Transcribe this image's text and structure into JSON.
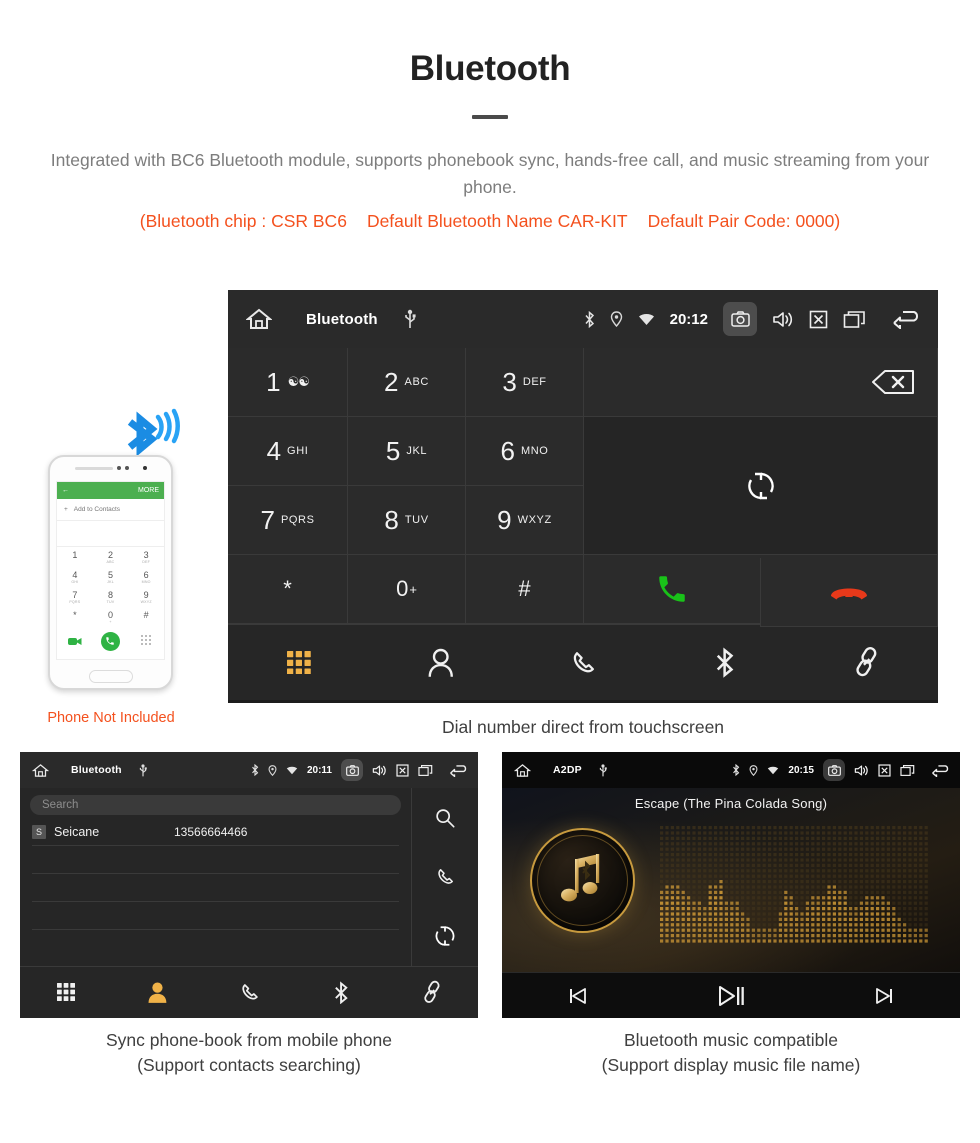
{
  "header": {
    "title": "Bluetooth",
    "subtitle": "Integrated with BC6 Bluetooth module, supports phonebook sync, hands-free call, and music streaming from your phone.",
    "spec_chip": "(Bluetooth chip : CSR BC6",
    "spec_name": "Default Bluetooth Name CAR-KIT",
    "spec_pair": "Default Pair Code: 0000)"
  },
  "colors": {
    "accent_orange": "#f4511e",
    "active_nav": "#f0b248",
    "call_green": "#19c219",
    "hangup_red": "#e8391a",
    "gold": "#c79a3e"
  },
  "phone_illustration": {
    "note": "Phone Not Included",
    "screen_header_more": "MORE",
    "add_contacts": "Add to Contacts",
    "keys": [
      {
        "num": "1",
        "sub": ""
      },
      {
        "num": "2",
        "sub": "ABC"
      },
      {
        "num": "3",
        "sub": "DEF"
      },
      {
        "num": "4",
        "sub": "GHI"
      },
      {
        "num": "5",
        "sub": "JKL"
      },
      {
        "num": "6",
        "sub": "MNO"
      },
      {
        "num": "7",
        "sub": "PQRS"
      },
      {
        "num": "8",
        "sub": "TUV"
      },
      {
        "num": "9",
        "sub": "WXYZ"
      },
      {
        "num": "*",
        "sub": ""
      },
      {
        "num": "0",
        "sub": "+"
      },
      {
        "num": "#",
        "sub": ""
      }
    ]
  },
  "dialer": {
    "status": {
      "title": "Bluetooth",
      "time": "20:12",
      "icons": [
        "home-icon",
        "usb-icon",
        "bluetooth-icon",
        "location-icon",
        "wifi-icon",
        "camera-icon",
        "volume-icon",
        "close-box-icon",
        "recents-icon",
        "back-icon"
      ]
    },
    "keys": [
      {
        "num": "1",
        "sub": "",
        "voicemail": true
      },
      {
        "num": "2",
        "sub": "ABC"
      },
      {
        "num": "3",
        "sub": "DEF"
      },
      {
        "num": "4",
        "sub": "GHI"
      },
      {
        "num": "5",
        "sub": "JKL"
      },
      {
        "num": "6",
        "sub": "MNO"
      },
      {
        "num": "7",
        "sub": "PQRS"
      },
      {
        "num": "8",
        "sub": "TUV"
      },
      {
        "num": "9",
        "sub": "WXYZ"
      },
      {
        "num": "*",
        "sub": ""
      },
      {
        "num": "0",
        "sub": "+"
      },
      {
        "num": "#",
        "sub": ""
      }
    ],
    "number_display": "",
    "nav": [
      {
        "name": "keypad",
        "label": "keypad-icon",
        "active": true
      },
      {
        "name": "contacts",
        "label": "person-icon",
        "active": false
      },
      {
        "name": "call-log",
        "label": "phone-icon",
        "active": false
      },
      {
        "name": "bluetooth",
        "label": "bluetooth-icon",
        "active": false
      },
      {
        "name": "pair-link",
        "label": "link-icon",
        "active": false
      }
    ],
    "caption": "Dial number direct from touchscreen"
  },
  "phonebook": {
    "status": {
      "title": "Bluetooth",
      "time": "20:11"
    },
    "search_placeholder": "Search",
    "search_value": "",
    "contacts": [
      {
        "initial": "S",
        "name": "Seicane",
        "number": "13566664466"
      }
    ],
    "empty_rows": 3,
    "side_actions": [
      "search-icon",
      "phone-icon",
      "sync-icon"
    ],
    "nav": [
      {
        "name": "keypad",
        "label": "keypad-icon",
        "active": false
      },
      {
        "name": "contacts",
        "label": "person-icon",
        "active": true
      },
      {
        "name": "call-log",
        "label": "phone-icon",
        "active": false
      },
      {
        "name": "bluetooth",
        "label": "bluetooth-icon",
        "active": false
      },
      {
        "name": "pair-link",
        "label": "link-icon",
        "active": false
      }
    ],
    "caption_line1": "Sync phone-book from mobile phone",
    "caption_line2": "(Support contacts searching)"
  },
  "music": {
    "status": {
      "title": "A2DP",
      "time": "20:15"
    },
    "song_title": "Escape (The Pina Colada Song)",
    "controls": [
      "previous-icon",
      "play-pause-icon",
      "next-icon"
    ],
    "caption_line1": "Bluetooth music compatible",
    "caption_line2": "(Support display music file name)"
  }
}
